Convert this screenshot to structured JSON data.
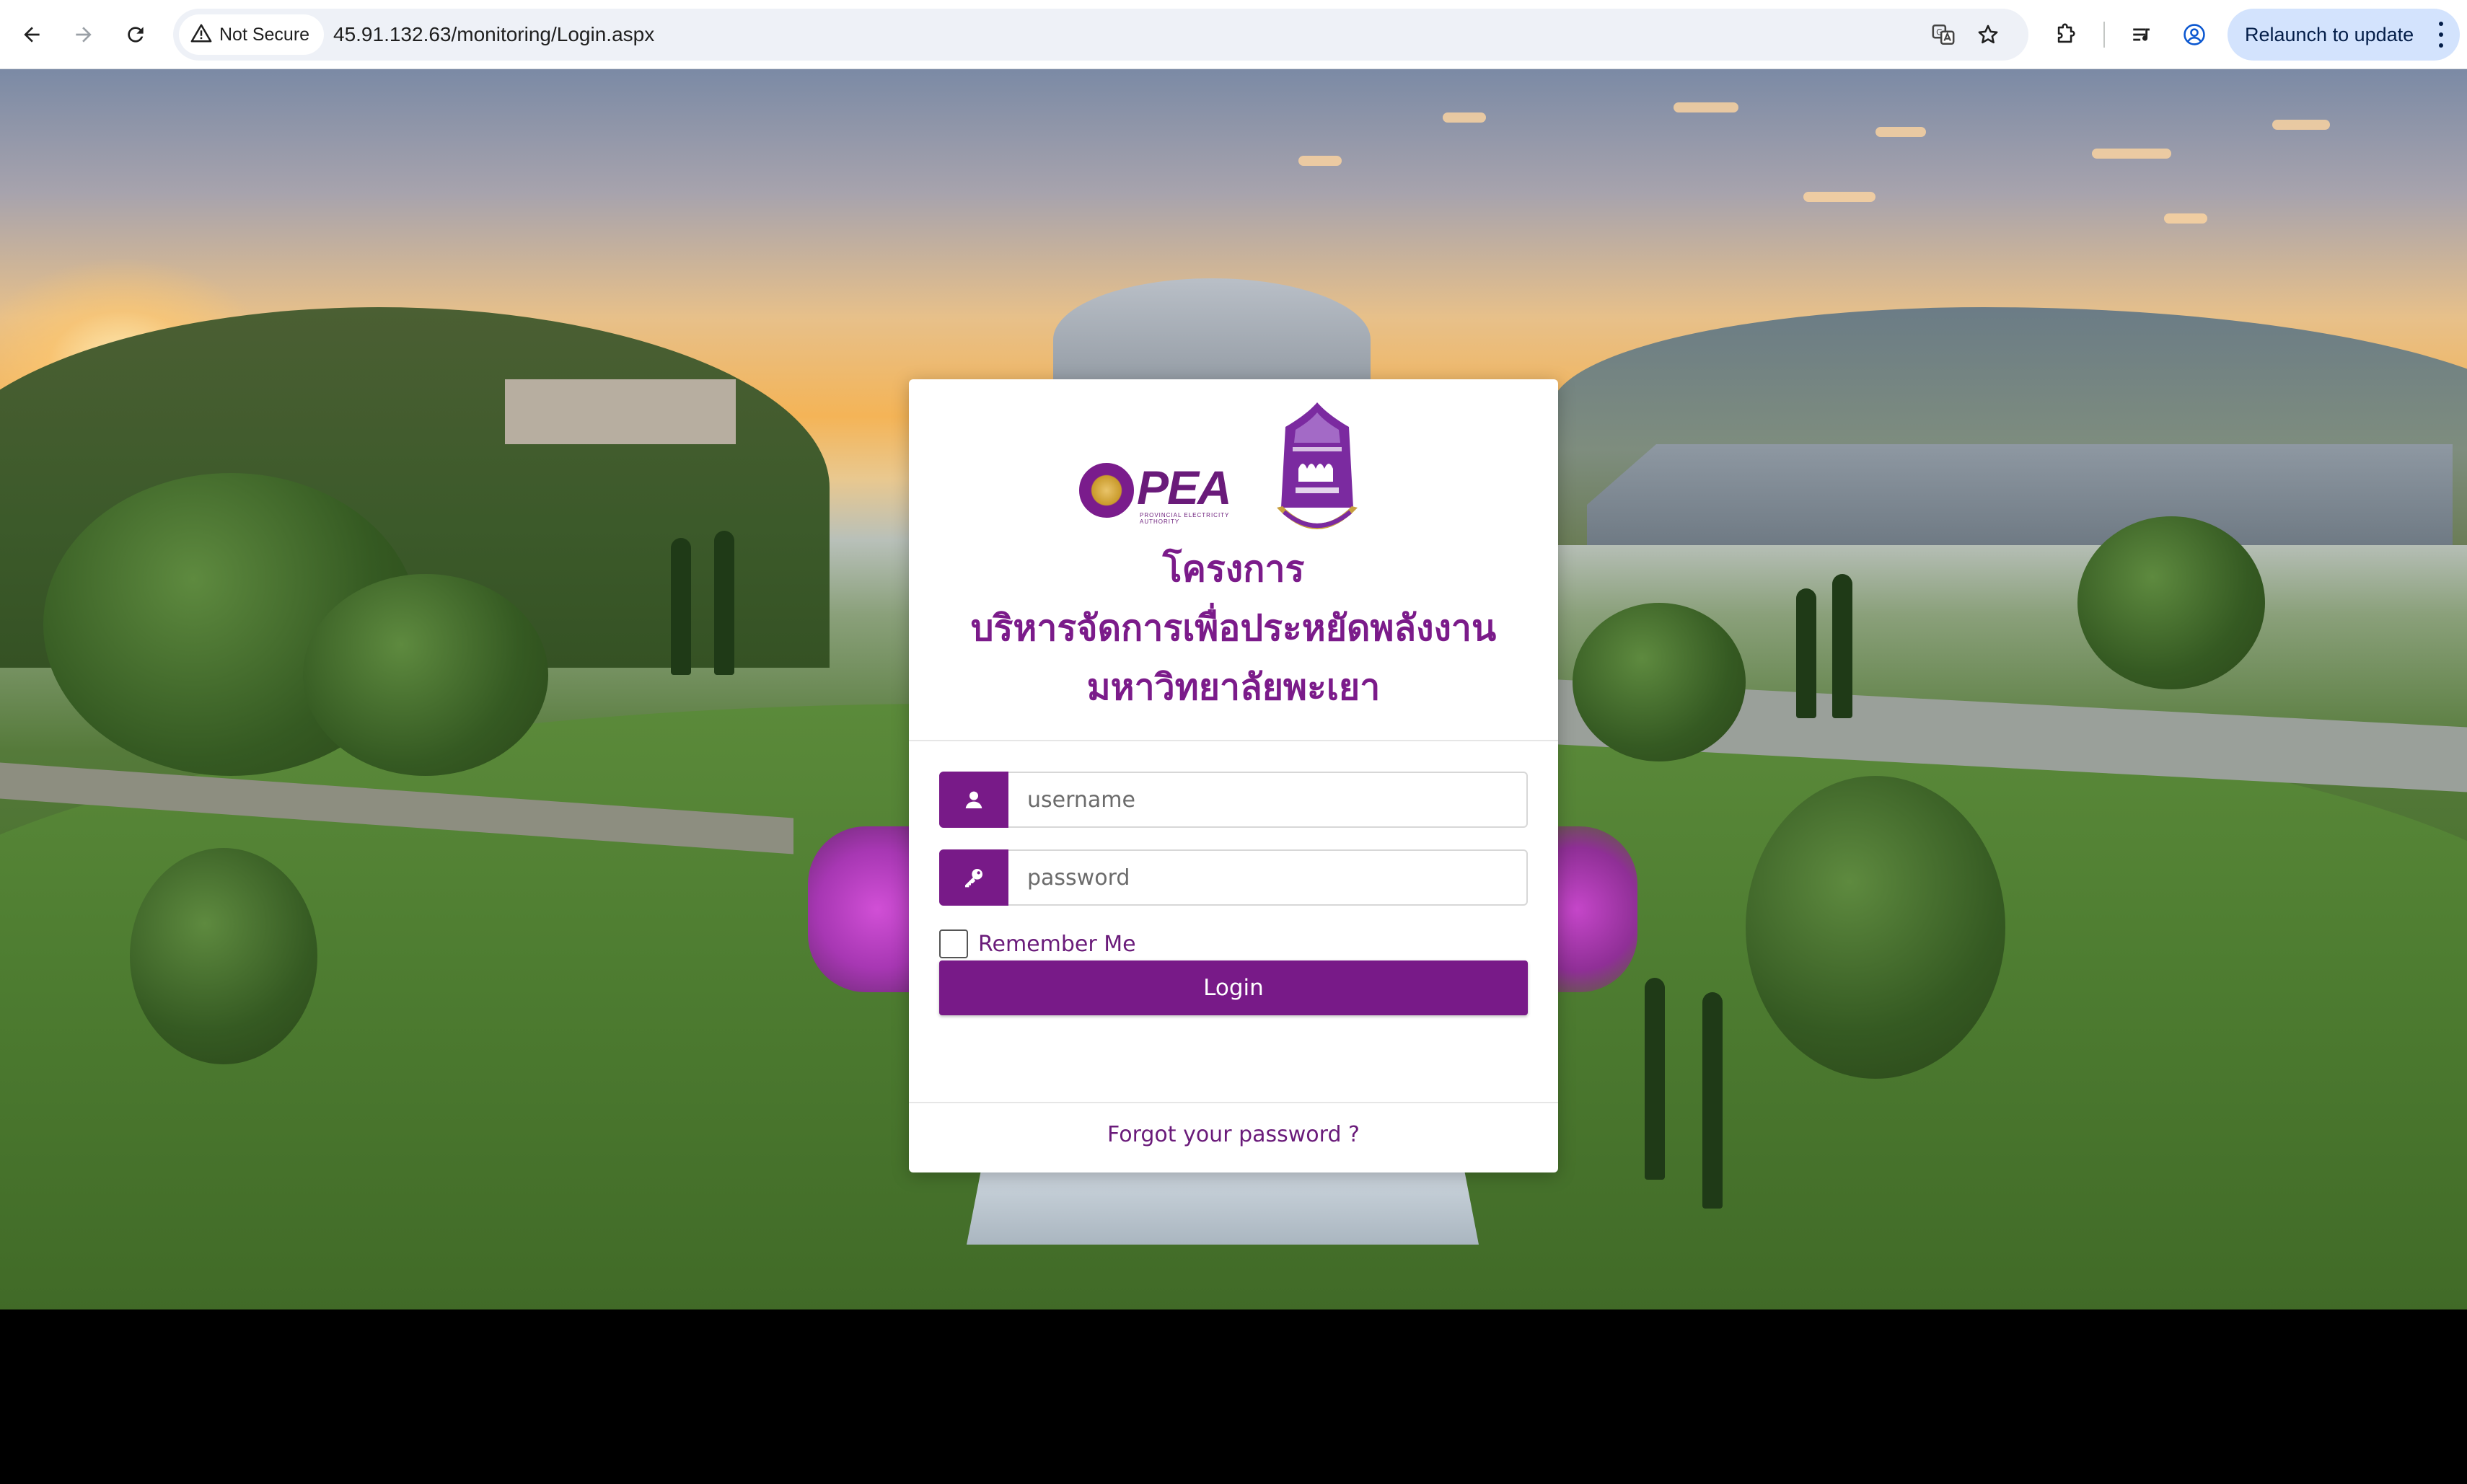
{
  "browser": {
    "security_label": "Not Secure",
    "url": "45.91.132.63/monitoring/Login.aspx",
    "relaunch_label": "Relaunch to update",
    "icons": [
      "back-icon",
      "forward-icon",
      "reload-icon",
      "warning-icon",
      "translate-icon",
      "star-icon",
      "extensions-icon",
      "media-controls-icon",
      "profile-icon",
      "more-menu-icon"
    ]
  },
  "login": {
    "logos": {
      "pea_text": "PEA",
      "pea_subtext": "PROVINCIAL ELECTRICITY AUTHORITY"
    },
    "title_line1": "โครงการ",
    "title_line2": "บริหารจัดการเพื่อประหยัดพลังงาน",
    "title_line3": "มหาวิทยาลัยพะเยา",
    "username_placeholder": "username",
    "password_placeholder": "password",
    "remember_label": "Remember Me",
    "remember_checked": false,
    "login_button": "Login",
    "forgot_link": "Forgot your password ?"
  },
  "colors": {
    "brand_purple": "#781a88",
    "title_purple": "#7b1b8a",
    "relaunch_bg": "#d3e3fd"
  }
}
